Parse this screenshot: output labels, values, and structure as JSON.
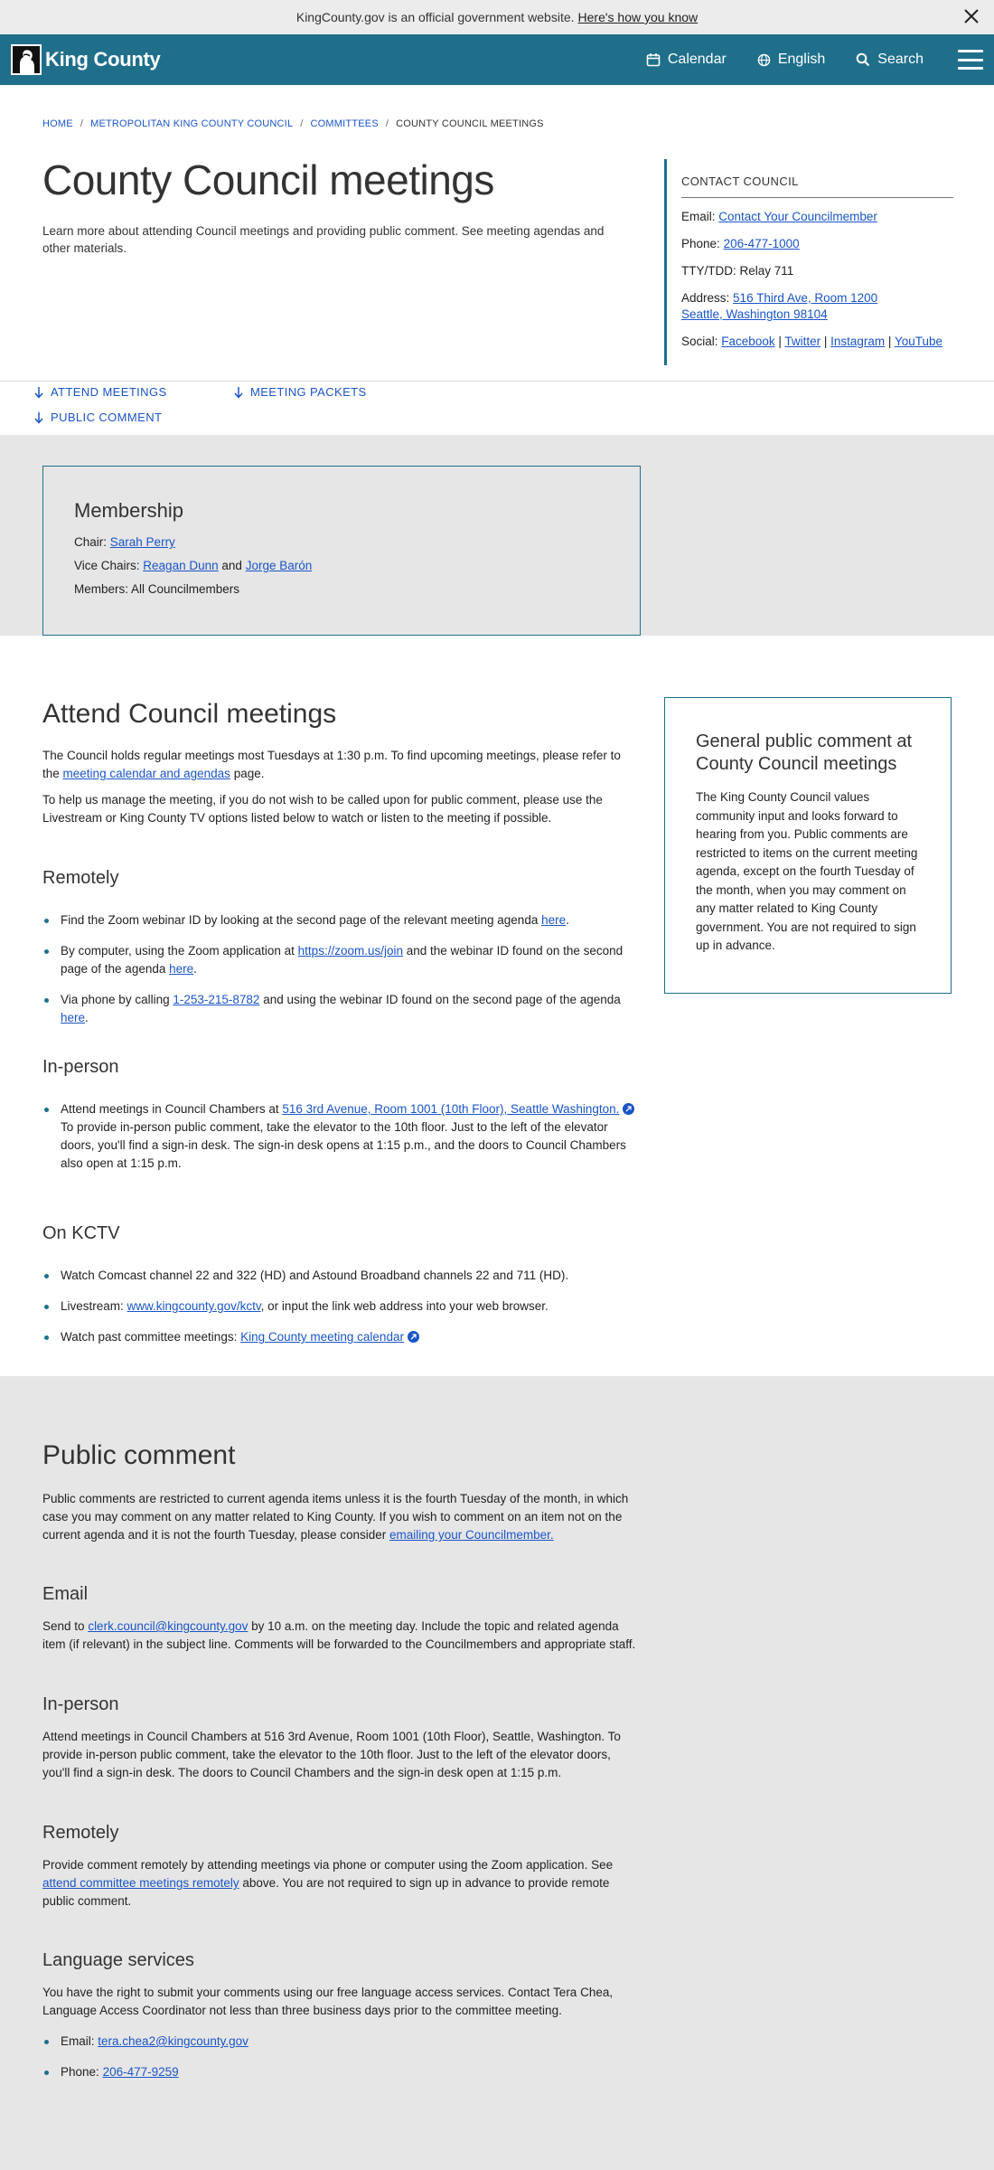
{
  "banner": {
    "text": "KingCounty.gov is an official government website.",
    "link": "Here's how you know"
  },
  "header": {
    "logo_text": "King County",
    "nav": {
      "calendar": "Calendar",
      "language": "English",
      "search": "Search"
    }
  },
  "breadcrumb": {
    "items": [
      "HOME",
      "METROPOLITAN KING COUNTY COUNCIL",
      "COMMITTEES"
    ],
    "current": "COUNTY COUNCIL MEETINGS"
  },
  "page": {
    "title": "County Council meetings",
    "intro": "Learn more about attending Council meetings and providing public comment. See meeting agendas and other materials."
  },
  "contact": {
    "heading": "CONTACT COUNCIL",
    "email_label": "Email:",
    "email_link": "Contact Your Councilmember",
    "phone_label": "Phone:",
    "phone": "206-477-1000",
    "tty": "TTY/TDD: Relay 711",
    "address_label": "Address:",
    "address_line1": "516 Third Ave, Room 1200",
    "address_line2": "Seattle, Washington 98104",
    "social_label": "Social:",
    "social": [
      "Facebook",
      "Twitter",
      "Instagram",
      "YouTube"
    ]
  },
  "anchors": {
    "attend": "ATTEND MEETINGS",
    "packets": "MEETING PACKETS",
    "comment": "PUBLIC COMMENT"
  },
  "membership": {
    "title": "Membership",
    "chair_label": "Chair:",
    "chair": "Sarah Perry",
    "vice_label": "Vice Chairs:",
    "vice1": "Reagan Dunn",
    "and": "and",
    "vice2": "Jorge Barón",
    "members": "Members: All Councilmembers"
  },
  "attend": {
    "title": "Attend Council meetings",
    "p1_a": "The Council holds regular meetings most Tuesdays at 1:30 p.m. To find upcoming meetings, please refer to the",
    "p1_link": "meeting calendar and agendas",
    "p1_b": "page.",
    "p2": "To help us manage the meeting, if you do not wish to be called upon for public comment, please use the Livestream or King County TV options listed below to watch or listen to the meeting if possible.",
    "remote_title": "Remotely",
    "r1_a": "Find the Zoom webinar ID by looking at the second page of the relevant meeting agenda",
    "r1_link": "here",
    "r2_a": "By computer, using the Zoom application at",
    "r2_link1": "https://zoom.us/join",
    "r2_b": "and the webinar ID found on the second page of the agenda",
    "r2_link2": "here",
    "r3_a": "Via phone by calling",
    "r3_link1": "1-253-215-8782",
    "r3_b": "and using the webinar ID found on the second page of the agenda",
    "r3_link2": "here",
    "inperson_title": "In-person",
    "ip_a": "Attend meetings in Council Chambers at",
    "ip_link": "516 3rd Avenue, Room 1001 (10th Floor), Seattle Washington.",
    "ip_b": "To provide in-person public comment, take the elevator to the 10th floor. Just to the left of the elevator doors, you'll find a sign-in desk. The sign-in desk opens at 1:15 p.m., and the doors to Council Chambers also open at 1:15 p.m.",
    "kctv_title": "On KCTV",
    "k1": "Watch Comcast channel 22 and 322 (HD) and Astound Broadband channels 22 and 711 (HD).",
    "k2_a": "Livestream:",
    "k2_link": "www.kingcounty.gov/kctv",
    "k2_b": ", or input the link web address into your web browser.",
    "k3_a": "Watch past committee meetings:",
    "k3_link": "King County meeting calendar"
  },
  "callout": {
    "title": "General public comment at County Council meetings",
    "text": "The King County Council values community input and looks forward to hearing from you. Public comments are restricted to items on the current meeting agenda, except on the fourth Tuesday of the month, when you may comment on any matter related to King County government. You are not required to sign up in advance."
  },
  "public_comment": {
    "title": "Public comment",
    "intro_a": "Public comments are restricted to current agenda items unless it is the fourth Tuesday of the month, in which case you may comment on any matter related to King County. If you wish to comment on an item not on the current agenda and it is not the fourth Tuesday, please consider",
    "intro_link": "emailing your Councilmember.",
    "email_title": "Email",
    "email_a": "Send to",
    "email_link": "clerk.council@kingcounty.gov",
    "email_b": "by 10 a.m. on the meeting day. Include the topic and related agenda item (if relevant) in the subject line. Comments will be forwarded to the Councilmembers and appropriate staff.",
    "inperson_title": "In-person",
    "inperson_text": "Attend meetings in Council Chambers at 516 3rd Avenue, Room 1001 (10th Floor), Seattle, Washington. To provide in-person public comment, take the elevator to the 10th floor. Just to the left of the elevator doors, you'll find a sign-in desk. The doors to Council Chambers and the sign-in desk open at 1:15 p.m.",
    "remote_title": "Remotely",
    "remote_a": "Provide comment remotely by attending meetings via phone or computer using the Zoom application. See",
    "remote_link": "attend committee meetings remotely",
    "remote_b": "above. You are not required to sign up in advance to provide remote public comment.",
    "lang_title": "Language services",
    "lang_text": "You have the right to submit your comments using our free language access services. Contact Tera Chea, Language Access Coordinator not less than three business days prior to the committee meeting.",
    "lang_email_label": "Email:",
    "lang_email": "tera.chea2@kingcounty.gov",
    "lang_phone_label": "Phone:",
    "lang_phone": "206-477-9259"
  }
}
